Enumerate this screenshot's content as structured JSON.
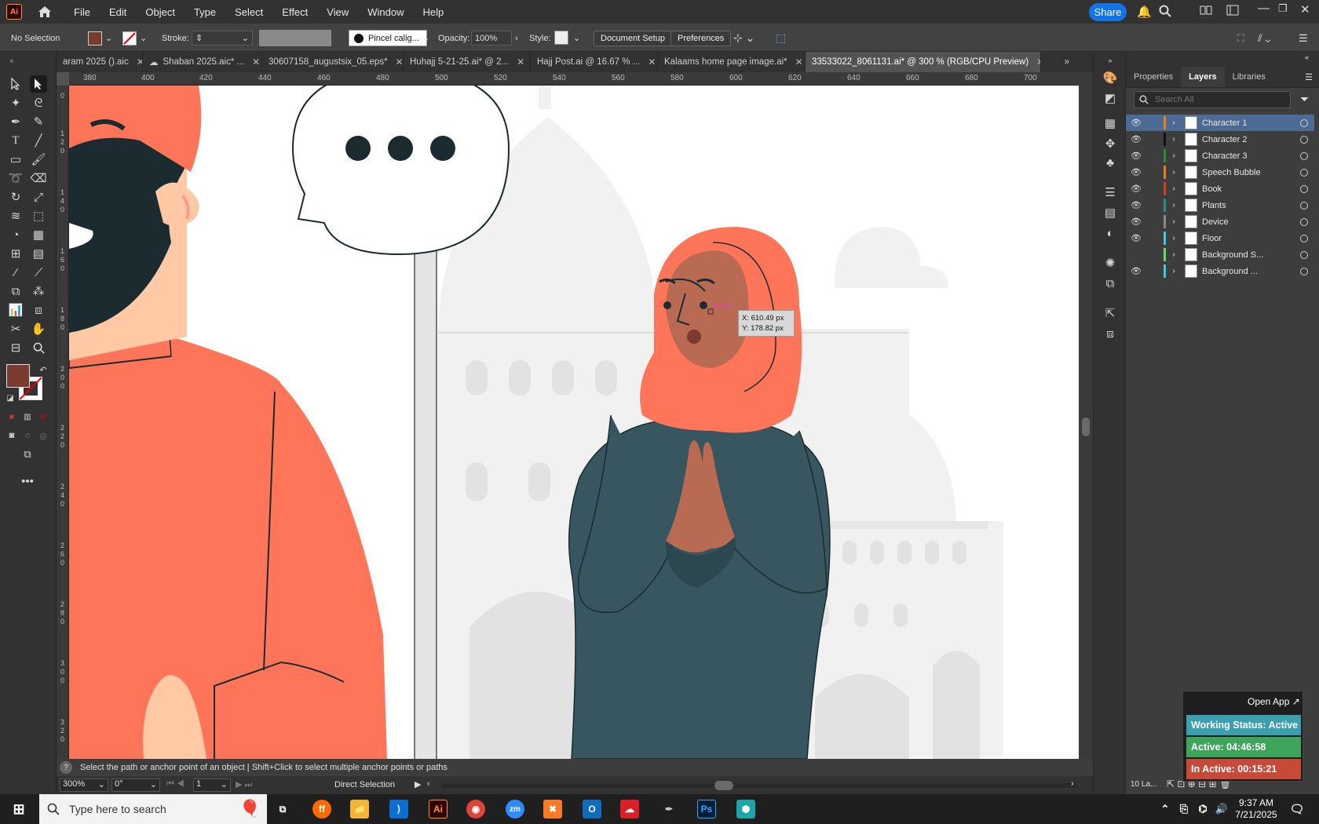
{
  "menubar": {
    "app_logo": "Ai",
    "items": [
      "File",
      "Edit",
      "Object",
      "Type",
      "Select",
      "Effect",
      "View",
      "Window",
      "Help"
    ],
    "share_label": "Share"
  },
  "controlbar": {
    "selection": "No Selection",
    "stroke_label": "Stroke:",
    "brush_name": "Pincel calig...",
    "opacity_label": "Opacity:",
    "opacity_value": "100%",
    "style_label": "Style:",
    "document_setup": "Document Setup",
    "preferences": "Preferences"
  },
  "tabs": [
    {
      "label": "aram 2025 ().aic",
      "active": false
    },
    {
      "label": "Shaban 2025.aic* ...",
      "active": false
    },
    {
      "label": "30607158_augustsix_05.eps*",
      "active": false
    },
    {
      "label": "Huhajj 5-21-25.ai* @ 2...",
      "active": false
    },
    {
      "label": "Hajj Post.ai @ 16.67 % ...",
      "active": false
    },
    {
      "label": "Kalaams home page image.ai*",
      "active": false
    },
    {
      "label": "33533022_8061131.ai* @ 300 % (RGB/CPU Preview)",
      "active": true
    }
  ],
  "ruler": {
    "top": [
      "380",
      "400",
      "420",
      "440",
      "460",
      "480",
      "500",
      "520",
      "540",
      "560",
      "580",
      "600",
      "620",
      "640",
      "660",
      "680",
      "700"
    ],
    "left": [
      "0",
      "1\n2\n0",
      "1\n4\n0",
      "1\n6\n0",
      "1\n8\n0",
      "2\n0\n0",
      "2\n2\n0",
      "2\n4\n0",
      "2\n6\n0",
      "2\n8\n0",
      "3\n0\n0",
      "3\n2\n0"
    ]
  },
  "tooltip": {
    "x": "X: 610.49 px",
    "y": "Y: 178.82 px",
    "hint": "anchor"
  },
  "status": {
    "hint": "Select the path or anchor point of an object  |  Shift+Click to select multiple anchor points or paths",
    "zoom": "300%",
    "rotation": "0°",
    "artboard": "1",
    "tool": "Direct Selection"
  },
  "panel": {
    "tabs": [
      "Properties",
      "Layers",
      "Libraries"
    ],
    "active_tab": "Layers",
    "search_placeholder": "Search All",
    "footer": "10 La...",
    "layers": [
      {
        "name": "Character 1",
        "color": "#e8801a",
        "selected": true,
        "visible": true
      },
      {
        "name": "Character 2",
        "color": "#111111",
        "selected": false,
        "visible": true
      },
      {
        "name": "Character 3",
        "color": "#2e8b2e",
        "selected": false,
        "visible": true
      },
      {
        "name": "Speech Bubble",
        "color": "#e8801a",
        "selected": false,
        "visible": true
      },
      {
        "name": "Book",
        "color": "#d04020",
        "selected": false,
        "visible": true
      },
      {
        "name": "Plants",
        "color": "#2a8a8a",
        "selected": false,
        "visible": true
      },
      {
        "name": "Device",
        "color": "#888888",
        "selected": false,
        "visible": true
      },
      {
        "name": "Floor",
        "color": "#3ec8e6",
        "selected": false,
        "visible": true
      },
      {
        "name": "Background S...",
        "color": "#6bd46b",
        "selected": false,
        "visible": false
      },
      {
        "name": "Background ...",
        "color": "#3ec8e6",
        "selected": false,
        "visible": true
      }
    ]
  },
  "widget": {
    "open_app": "Open App ↗",
    "working": "Working Status: Active",
    "active": "Active: 04:46:58",
    "inactive": "In Active: 00:15:21"
  },
  "taskbar": {
    "search_placeholder": "Type here to search",
    "time": "9:37 AM",
    "date": "7/21/2025"
  },
  "colors": {
    "fill": "#7a3b2e",
    "skin_woman": "#b86a52",
    "coral": "#ff7559",
    "teal_dress": "#37565f",
    "dark": "#1b2b2f",
    "bg_gray": "#f0f0f0"
  }
}
